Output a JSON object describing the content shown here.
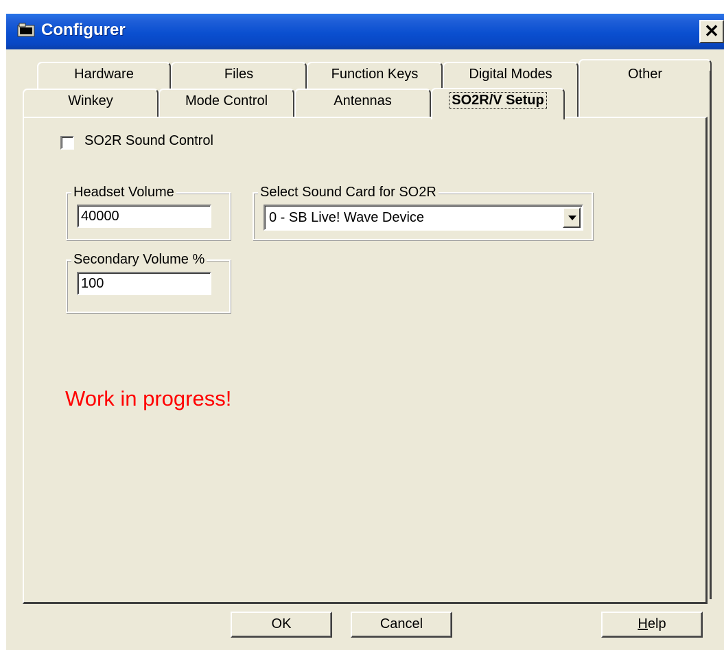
{
  "window": {
    "title": "Configurer",
    "close_label": "✕"
  },
  "tabs_back": [
    {
      "label": "Hardware"
    },
    {
      "label": "Files"
    },
    {
      "label": "Function Keys"
    },
    {
      "label": "Digital Modes"
    },
    {
      "label": "Other"
    }
  ],
  "tabs_front": [
    {
      "label": "Winkey"
    },
    {
      "label": "Mode Control"
    },
    {
      "label": "Antennas"
    },
    {
      "label": "SO2R/V Setup",
      "active": true
    }
  ],
  "panel": {
    "so2r_sound_control": {
      "label": "SO2R Sound Control",
      "checked": false
    },
    "headset_volume": {
      "title": "Headset Volume",
      "value": "40000"
    },
    "secondary_volume": {
      "title": "Secondary Volume %",
      "value": "100"
    },
    "sound_card": {
      "title": "Select Sound Card for SO2R",
      "selected": "0 - SB Live! Wave Device"
    },
    "notice": "Work in progress!"
  },
  "buttons": {
    "ok": "OK",
    "cancel": "Cancel",
    "help_mnemonic": "H",
    "help_rest": "elp"
  },
  "colors": {
    "titlebar": "#0a4fd0",
    "face": "#ece9d8",
    "notice": "#ff0000"
  }
}
